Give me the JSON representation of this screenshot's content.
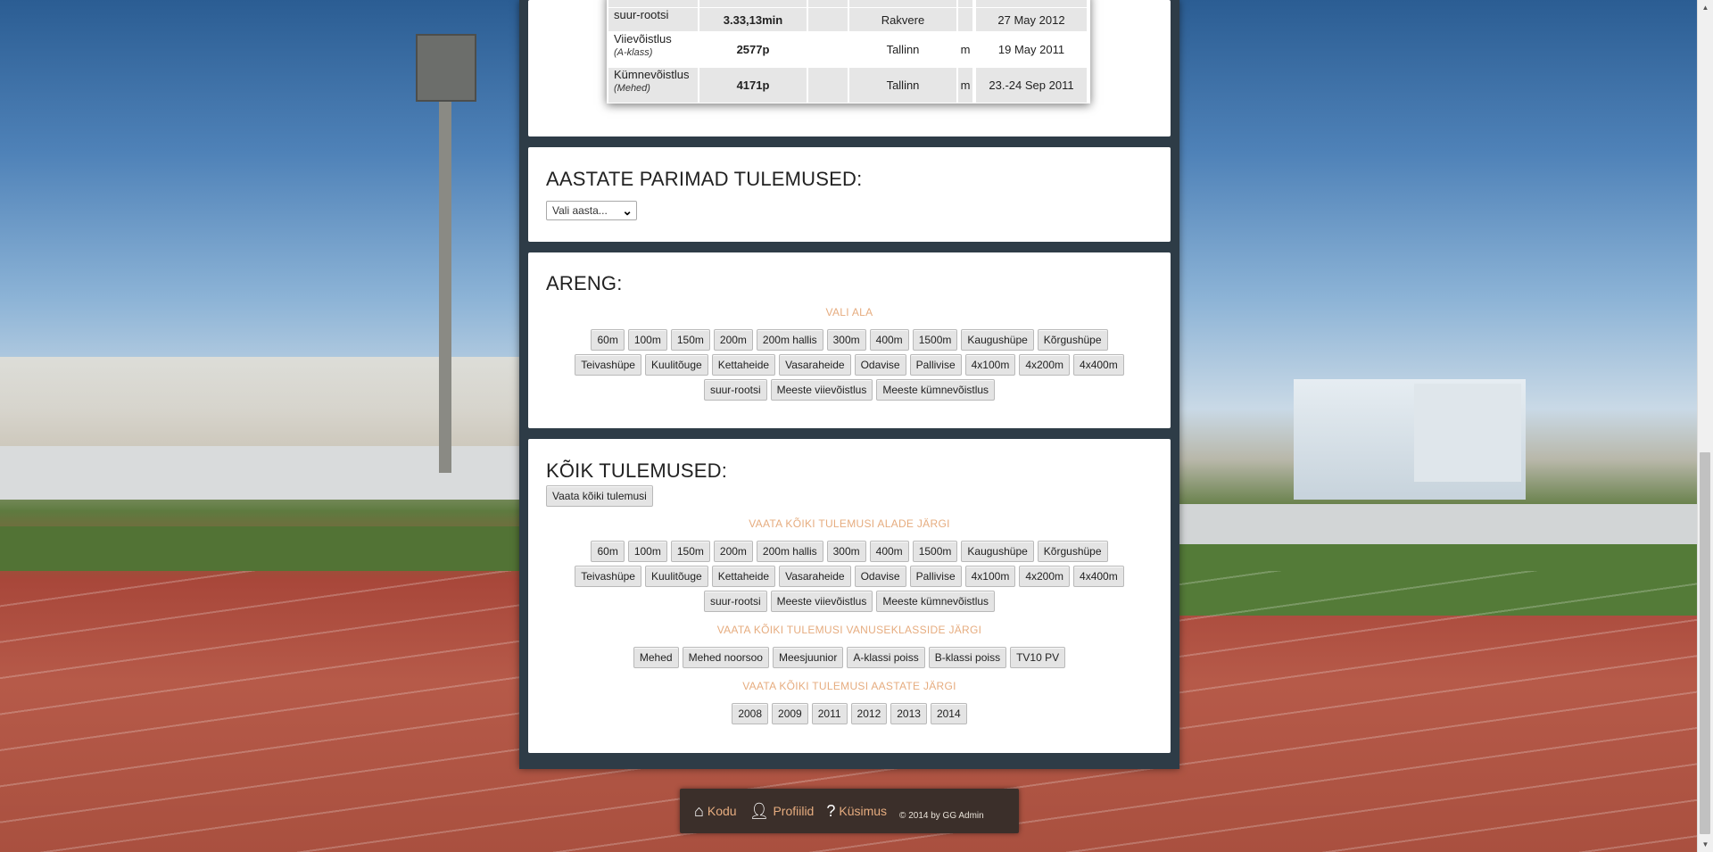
{
  "records": {
    "rows": [
      {
        "event": "suur-rootsi",
        "sub": "",
        "result": "3.33,13min",
        "place": "Rakvere",
        "m": "",
        "date": "27 May 2012",
        "shade": true
      },
      {
        "event": "Viievõistlus",
        "sub": "(A-klass)",
        "result": "2577p",
        "place": "Tallinn",
        "m": "m",
        "date": "19 May 2011",
        "shade": false
      },
      {
        "event": "Kümnevõistlus",
        "sub": "(Mehed)",
        "result": "4171p",
        "place": "Tallinn",
        "m": "m",
        "date": "23.-24 Sep 2011",
        "shade": true
      }
    ]
  },
  "aastate": {
    "title": "AASTATE PARIMAD TULEMUSED:",
    "select_value": "Vali aasta..."
  },
  "areng": {
    "title": "ARENG:",
    "label": "VALI ALA",
    "rows": [
      [
        "60m",
        "100m",
        "150m",
        "200m",
        "200m hallis",
        "300m",
        "400m",
        "1500m",
        "Kaugushüpe",
        "Kõrgushüpe"
      ],
      [
        "Teivashüpe",
        "Kuulitõuge",
        "Kettaheide",
        "Vasaraheide",
        "Odavise",
        "Pallivise",
        "4x100m",
        "4x200m",
        "4x400m"
      ],
      [
        "suur-rootsi",
        "Meeste viievõistlus",
        "Meeste kümnevõistlus"
      ]
    ]
  },
  "koik": {
    "title": "KÕIK TULEMUSED:",
    "all_button": "Vaata kõiki tulemusi",
    "label_events": "VAATA KÕIKI TULEMUSI ALADE JÄRGI",
    "event_rows": [
      [
        "60m",
        "100m",
        "150m",
        "200m",
        "200m hallis",
        "300m",
        "400m",
        "1500m",
        "Kaugushüpe",
        "Kõrgushüpe"
      ],
      [
        "Teivashüpe",
        "Kuulitõuge",
        "Kettaheide",
        "Vasaraheide",
        "Odavise",
        "Pallivise",
        "4x100m",
        "4x200m",
        "4x400m"
      ],
      [
        "suur-rootsi",
        "Meeste viievõistlus",
        "Meeste kümnevõistlus"
      ]
    ],
    "label_age": "VAATA KÕIKI TULEMUSI VANUSEKLASSIDE JÄRGI",
    "age_buttons": [
      "Mehed",
      "Mehed noorsoo",
      "Meesjuunior",
      "A-klassi poiss",
      "B-klassi poiss",
      "TV10 PV"
    ],
    "label_years": "VAATA KÕIKI TULEMUSI AASTATE JÄRGI",
    "year_buttons": [
      "2008",
      "2009",
      "2011",
      "2012",
      "2013",
      "2014"
    ]
  },
  "footer": {
    "home": "Kodu",
    "profiles": "Profiilid",
    "question": "Küsimus",
    "copyright": "© 2014 by GG Admin",
    "accent": "#e6ac7f"
  }
}
